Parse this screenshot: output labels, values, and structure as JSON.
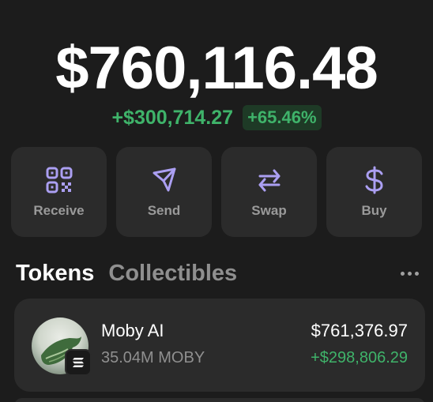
{
  "portfolio": {
    "balance": "$760,116.48",
    "change_abs": "+$300,714.27",
    "change_pct": "+65.46%"
  },
  "actions": [
    {
      "label": "Receive",
      "icon": "qr-code-icon"
    },
    {
      "label": "Send",
      "icon": "send-icon"
    },
    {
      "label": "Swap",
      "icon": "swap-icon"
    },
    {
      "label": "Buy",
      "icon": "dollar-icon"
    }
  ],
  "tabs": {
    "tokens": "Tokens",
    "collectibles": "Collectibles",
    "more_icon": "more-dots-icon"
  },
  "tokens": [
    {
      "name": "Moby AI",
      "amount": "35.04M MOBY",
      "value": "$761,376.97",
      "change": "+$298,806.29",
      "chain_icon": "solana-icon"
    }
  ],
  "colors": {
    "background": "#1c1c1c",
    "card": "#2b2b2b",
    "accent": "#ab9ff2",
    "positive": "#3fb36a"
  }
}
